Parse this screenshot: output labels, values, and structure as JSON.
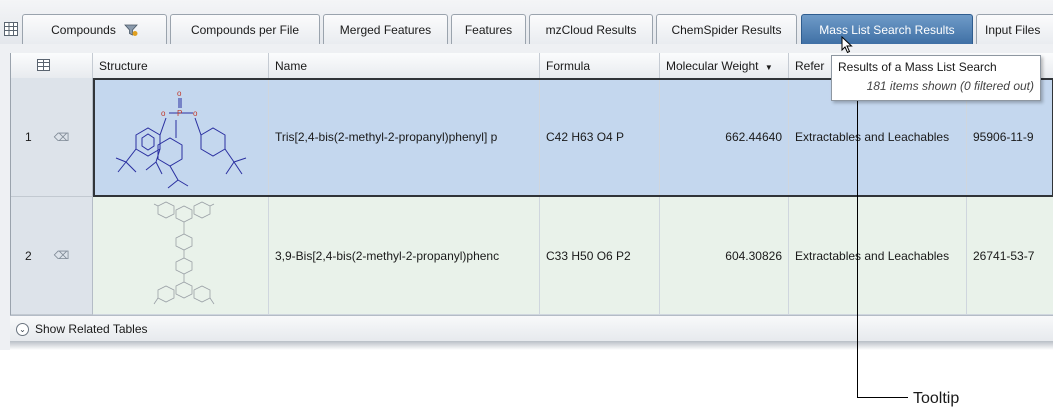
{
  "tabs": [
    {
      "label": "Compounds",
      "active": false,
      "has_filter_icon": true
    },
    {
      "label": "Compounds per File",
      "active": false
    },
    {
      "label": "Merged Features",
      "active": false
    },
    {
      "label": "Features",
      "active": false
    },
    {
      "label": "mzCloud Results",
      "active": false
    },
    {
      "label": "ChemSpider Results",
      "active": false
    },
    {
      "label": "Mass List Search Results",
      "active": true
    },
    {
      "label": "Input Files",
      "active": false
    }
  ],
  "table": {
    "columns": [
      "Structure",
      "Name",
      "Formula",
      "Molecular Weight",
      "Refer"
    ],
    "sort_column": "Molecular Weight",
    "rows": [
      {
        "index": "1",
        "name": "Tris[2,4-bis(2-methyl-2-propanyl)phenyl] p",
        "formula": "C42 H63 O4 P",
        "mw": "662.44640",
        "ref": "Extractables and Leachables",
        "cas": "95906-11-9",
        "selected": true
      },
      {
        "index": "2",
        "name": "3,9-Bis[2,4-bis(2-methyl-2-propanyl)phenc",
        "formula": "C33 H50 O6 P2",
        "mw": "604.30826",
        "ref": "Extractables and Leachables",
        "cas": "26741-53-7",
        "selected": false
      }
    ]
  },
  "footer": {
    "label": "Show Related Tables"
  },
  "tooltip": {
    "title": "Results of a Mass List Search",
    "subtitle": "181 items shown (0 filtered out)"
  },
  "callout": {
    "label": "Tooltip"
  },
  "colors": {
    "active_tab": "#3f70a5",
    "selected_row": "#c4d7ee",
    "row2_bg": "#e9f2ea"
  }
}
